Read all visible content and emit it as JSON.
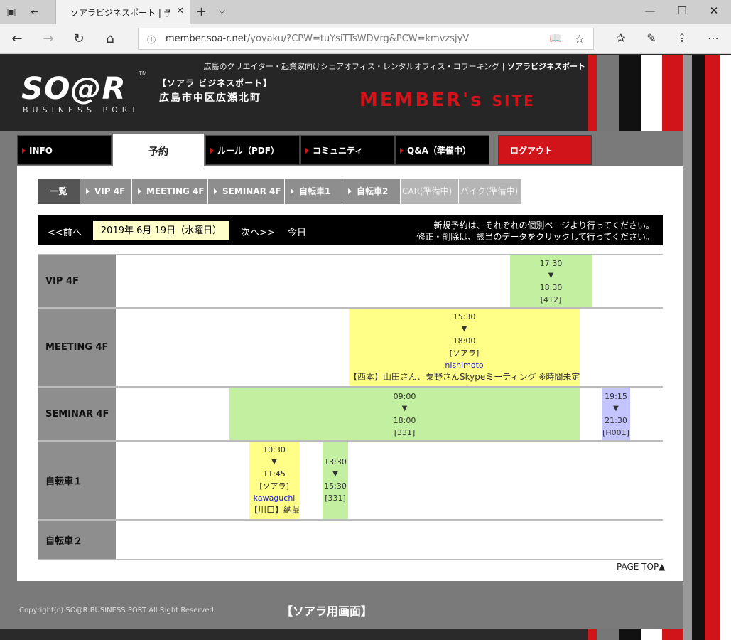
{
  "browser": {
    "tab_title": "ソアラビジネスポート | 予約·",
    "url_host": "member.soa-r.net",
    "url_path": "/yoyaku/?CPW=tuYsiTTsWDVrg&PCW=kmvzsjyV"
  },
  "header": {
    "logo": "SO@R",
    "logo_sub": "BUSINESS PORT",
    "tm": "TM",
    "location_line1": "【ソアラ ビジネスポート】",
    "location_line2": "広島市中区広瀬北町",
    "tagline": "広島のクリエイター・起業家向けシェアオフィス・レンタルオフィス・コワーキング |",
    "tagline_brand": "ソアラビジネスポート",
    "member_big": "MEMBER's",
    "member_small": "SITE"
  },
  "topnav": [
    "INFO",
    "予約",
    "ルール（PDF）",
    "コミュニティ",
    "Q&A（準備中）",
    "ログアウト"
  ],
  "subnav": [
    "一覧",
    "VIP 4F",
    "MEETING 4F",
    "SEMINAR 4F",
    "自転車1",
    "自転車2",
    "CAR(準備中)",
    "バイク(準備中)"
  ],
  "datebar": {
    "prev": "<<前へ",
    "date": "2019年 6月 19日（水曜日）",
    "next": "次へ>>",
    "today": "今日",
    "note1": "新規予約は、それぞれの個別ページより行ってください。",
    "note2": "修正・削除は、該当のデータをクリックして行ってください。"
  },
  "rows": [
    {
      "label": "VIP 4F"
    },
    {
      "label": "MEETING 4F"
    },
    {
      "label": "SEMINAR 4F"
    },
    {
      "label": "自転車１"
    },
    {
      "label": "自転車２"
    }
  ],
  "bookings": {
    "vip1": {
      "start": "17:30",
      "arrow": "▼",
      "end": "18:30",
      "room": "[412]"
    },
    "meet1": {
      "start": "15:30",
      "arrow": "▼",
      "end": "18:00",
      "org": "[ソアラ]",
      "user": "nishimoto",
      "note": "【西本】山田さん、粟野さんSkypeミーティング ※時間未定"
    },
    "sem1": {
      "start": "09:00",
      "arrow": "▼",
      "end": "18:00",
      "room": "[331]"
    },
    "sem2": {
      "start": "19:15",
      "arrow": "▼",
      "end": "21:30",
      "room": "[H001]"
    },
    "bike1a": {
      "start": "10:30",
      "arrow": "▼",
      "end": "11:45",
      "org": "[ソアラ]",
      "user": "kawaguchi",
      "note": "【川口】納品"
    },
    "bike1b": {
      "start": "13:30",
      "arrow": "▼",
      "end": "15:30",
      "room": "[331]"
    }
  },
  "pagetop": "PAGE TOP▲",
  "footer": {
    "copyright": "Copyright(c) SO@R BUSINESS PORT All Right Reserved.",
    "caption": "【ソアラ用画面】"
  }
}
